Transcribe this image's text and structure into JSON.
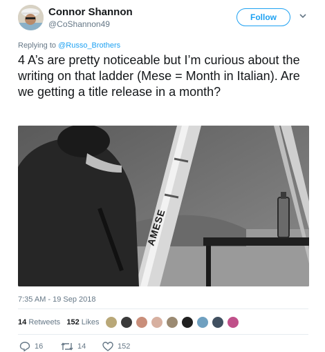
{
  "user": {
    "name": "Connor Shannon",
    "handle": "@CoShannon49"
  },
  "follow_label": "Follow",
  "reply": {
    "prefix": "Replying to ",
    "target": "@Russo_Brothers"
  },
  "tweet_text": "4 A’s are pretty noticeable but I’m curious about the writing on that ladder (Mese = Month in Italian). Are we getting a title release in a month?",
  "media": {
    "ladder_text": "AMESE"
  },
  "timestamp": "7:35 AM - 19 Sep 2018",
  "stats": {
    "retweets_count": "14",
    "retweets_label": "Retweets",
    "likes_count": "152",
    "likes_label": "Likes"
  },
  "likers": [
    "#b9a878",
    "#3a3a3a",
    "#c98e7a",
    "#d7b0a0",
    "#9b8a72",
    "#202020",
    "#6fa0c0",
    "#405060",
    "#c0508a"
  ],
  "actions": {
    "replies": "16",
    "retweets": "14",
    "likes": "152"
  },
  "colors": {
    "accent": "#1da1f2",
    "secondary_text": "#657786"
  }
}
